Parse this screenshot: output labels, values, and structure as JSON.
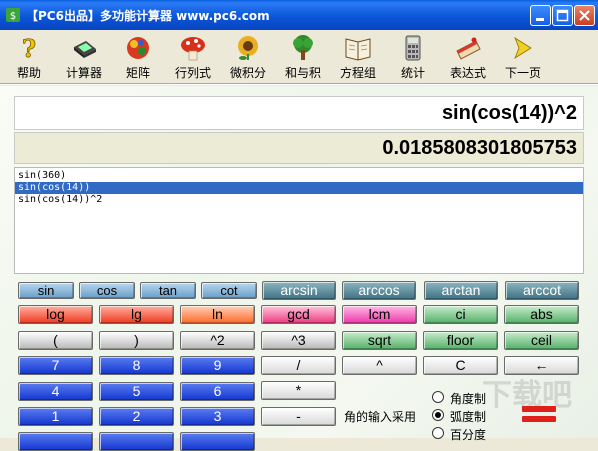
{
  "window": {
    "title": "【PC6出品】多功能计算器 www.pc6.com"
  },
  "toolbar": {
    "items": [
      {
        "label": "帮助",
        "icon": "help-icon"
      },
      {
        "label": "计算器",
        "icon": "calculator-icon"
      },
      {
        "label": "矩阵",
        "icon": "matrix-icon"
      },
      {
        "label": "行列式",
        "icon": "determinant-icon"
      },
      {
        "label": "微积分",
        "icon": "calculus-icon"
      },
      {
        "label": "和与积",
        "icon": "sum-product-icon"
      },
      {
        "label": "方程组",
        "icon": "equations-icon"
      },
      {
        "label": "统计",
        "icon": "statistics-icon"
      },
      {
        "label": "表达式",
        "icon": "expression-icon"
      },
      {
        "label": "下一页",
        "icon": "next-page-icon"
      }
    ]
  },
  "display": {
    "expression": "sin(cos(14))^2",
    "result": "0.0185808301805753"
  },
  "history": [
    "sin(360)",
    "sin(cos(14))",
    "sin(cos(14))^2"
  ],
  "history_selected_index": 1,
  "keys": {
    "trig": [
      "sin",
      "cos",
      "tan",
      "cot"
    ],
    "arc": [
      "arcsin",
      "arccos",
      "arctan",
      "arccot"
    ],
    "row2": [
      "log",
      "lg",
      "ln",
      "gcd",
      "lcm",
      "ci",
      "abs"
    ],
    "row3": [
      "(",
      ")",
      "^2",
      "^3",
      "sqrt",
      "floor",
      "ceil"
    ],
    "row4": [
      "7",
      "8",
      "9",
      "/",
      "^",
      "C",
      "←"
    ],
    "row5": [
      "4",
      "5",
      "6",
      "*"
    ],
    "row6": [
      "1",
      "2",
      "3",
      "-"
    ]
  },
  "angle": {
    "label": "角的输入采用",
    "options": [
      "角度制",
      "弧度制",
      "百分度"
    ],
    "selected": 1
  },
  "watermark": "下载吧"
}
